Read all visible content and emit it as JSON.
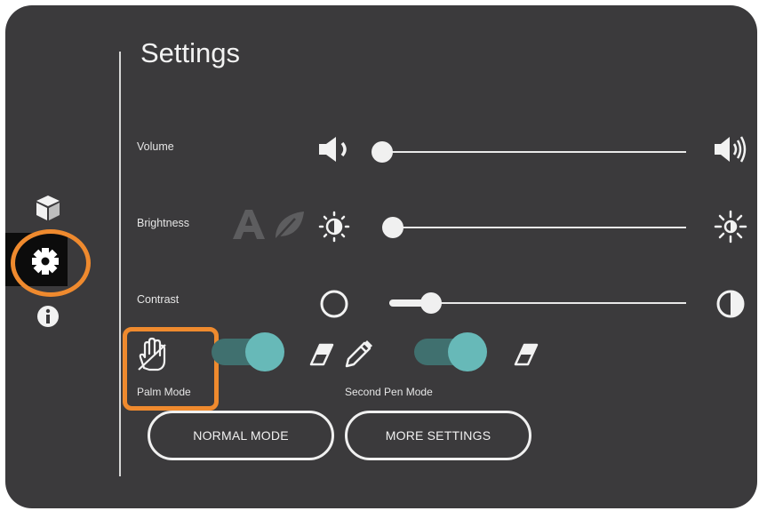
{
  "settings": {
    "title": "Settings",
    "volume_label": "Volume",
    "brightness_label": "Brightness",
    "contrast_label": "Contrast",
    "volume_level": 0,
    "brightness_level": 0,
    "contrast_level": 0.15,
    "palm_mode_label": "Palm Mode",
    "palm_mode_on": true,
    "second_pen_mode_label": "Second Pen Mode",
    "second_pen_mode_on": true,
    "normal_mode_label": "NORMAL MODE",
    "more_settings_label": "MORE SETTINGS"
  },
  "sidebar": {
    "items": [
      {
        "icon": "cube-icon"
      },
      {
        "icon": "gear-icon",
        "selected": true
      },
      {
        "icon": "info-icon"
      }
    ]
  },
  "colors": {
    "panel": "#3b3a3c",
    "accent_toggle": "#67b9b8",
    "highlight": "#ef8a2e"
  }
}
